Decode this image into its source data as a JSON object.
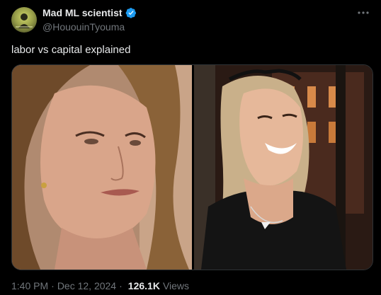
{
  "author": {
    "display_name": "Mad ML scientist",
    "handle": "@HououinTyouma",
    "verified": true
  },
  "post": {
    "text": "labor vs capital explained",
    "time": "1:40 PM",
    "separator": "·",
    "date": "Dec 12, 2024",
    "views_count": "126.1K",
    "views_label": "Views"
  },
  "icons": {
    "verified": "verified-badge-icon",
    "more": "more-options-icon"
  },
  "colors": {
    "background": "#000000",
    "text_primary": "#e7e9ea",
    "text_secondary": "#71767b",
    "verified_blue": "#1d9bf0",
    "border": "#2f3336"
  }
}
